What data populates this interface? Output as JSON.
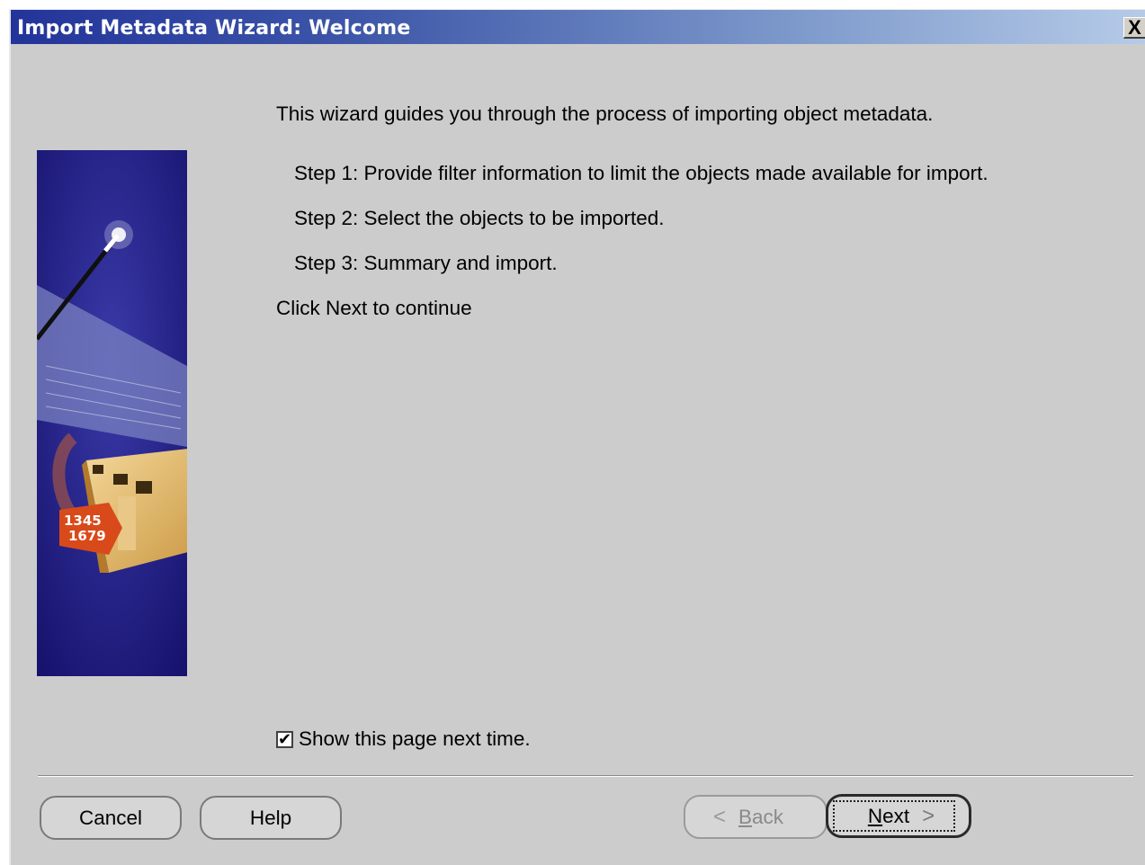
{
  "window": {
    "title": "Import Metadata Wizard: Welcome",
    "close_glyph": "X"
  },
  "content": {
    "intro": "This wizard guides you through the process of importing object metadata.",
    "steps": [
      "Step 1: Provide filter information to limit the objects made available for import.",
      "Step 2: Select the objects to be imported.",
      "Step 3: Summary and import."
    ],
    "continue_text": "Click Next to continue"
  },
  "banner": {
    "numbers_a": "1345",
    "numbers_b": "1679"
  },
  "options": {
    "show_page_label": "Show this page next time.",
    "show_page_checked": true
  },
  "buttons": {
    "cancel": "Cancel",
    "help": "Help",
    "back_mnemonic": "B",
    "back_rest": "ack",
    "back_enabled": false,
    "next_mnemonic": "N",
    "next_rest": "ext",
    "back_arrow": "<",
    "next_arrow": ">"
  },
  "colors": {
    "title_bar_start": "#23349a",
    "title_bar_end": "#b6cbe8",
    "dialog_bg": "#cccccc",
    "banner_bg": "#1a1370"
  }
}
